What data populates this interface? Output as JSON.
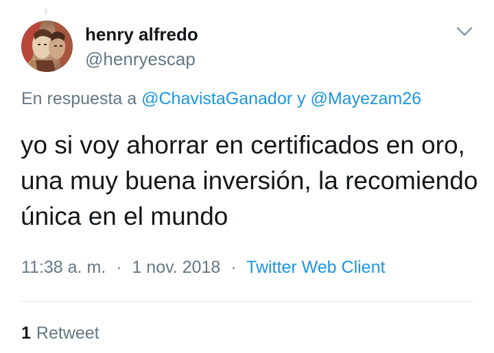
{
  "author": {
    "display_name": "henry alfredo",
    "handle": "@henryescap"
  },
  "reply": {
    "prefix": "En respuesta a",
    "mention_1": "@ChavistaGanador",
    "conjunction": "y",
    "mention_2": "@Mayezam26"
  },
  "tweet": {
    "text": "yo si voy ahorrar en certificados en oro, una muy buena inversión, la recomiendo única en el mundo"
  },
  "meta": {
    "time": "11:38 a. m.",
    "separator": "·",
    "date": "1 nov. 2018",
    "client": "Twitter Web Client"
  },
  "stats": {
    "retweet_count": "1",
    "retweet_label": "Retweet"
  },
  "icons": {
    "menu": "chevron-down-icon",
    "avatar": "avatar-image"
  },
  "colors": {
    "link": "#1b95e0",
    "secondary_text": "#657786",
    "primary_text": "#14171a",
    "divider": "#e1e8ed"
  }
}
